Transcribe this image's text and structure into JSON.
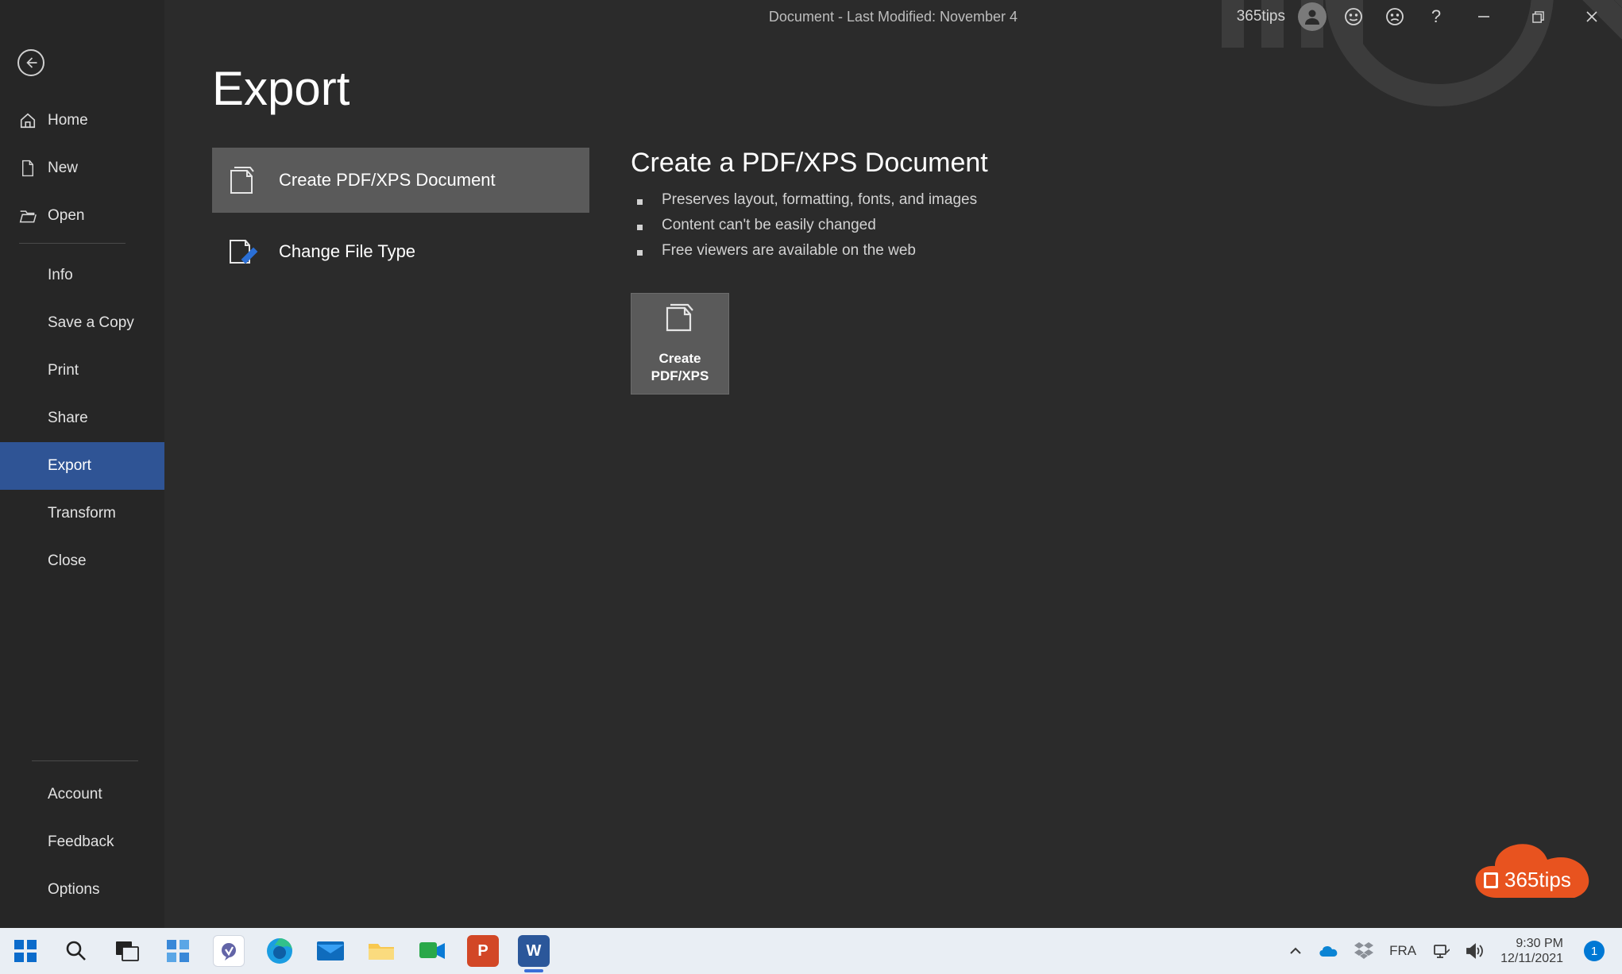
{
  "titlebar": {
    "doc_title": "Document  -  Last Modified: November 4",
    "username": "365tips"
  },
  "sidebar": {
    "home": "Home",
    "new": "New",
    "open": "Open",
    "info": "Info",
    "save_copy": "Save a Copy",
    "print": "Print",
    "share": "Share",
    "export": "Export",
    "transform": "Transform",
    "close": "Close",
    "account": "Account",
    "feedback": "Feedback",
    "options": "Options"
  },
  "main": {
    "title": "Export",
    "opt_pdf": "Create PDF/XPS Document",
    "opt_filetype": "Change File Type",
    "detail_title": "Create a PDF/XPS Document",
    "b1": "Preserves layout, formatting, fonts, and images",
    "b2": "Content can't be easily changed",
    "b3": "Free viewers are available on the web",
    "big_btn_l1": "Create",
    "big_btn_l2": "PDF/XPS"
  },
  "watermark": "365tips",
  "taskbar": {
    "lang": "FRA",
    "time": "9:30 PM",
    "date": "12/11/2021",
    "notif": "1"
  }
}
